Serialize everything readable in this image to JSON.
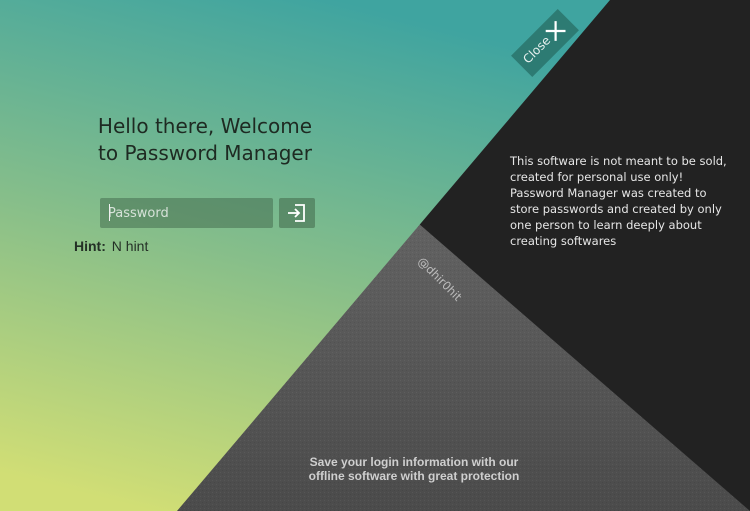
{
  "welcome": {
    "line1": "Hello there, Welcome",
    "line2": "to Password Manager"
  },
  "password": {
    "placeholder": "Password",
    "value": ""
  },
  "login": {
    "icon": "login-arrow-icon"
  },
  "hint": {
    "label": "Hint:",
    "value": "N hint"
  },
  "close": {
    "label": "Close",
    "icon": "close-x-icon"
  },
  "info": {
    "text": "This software is not meant to be sold, created for personal use only! Password Manager was created to store passwords and created by only one person to learn deeply about creating softwares"
  },
  "watermark": {
    "text": "@dhir0hit"
  },
  "tagline": {
    "line1": "Save your login information with our",
    "line2": "offline software with great protection"
  },
  "colors": {
    "gradient_top": "#3fa4a0",
    "gradient_bottom": "#cedd78",
    "dark_panel": "#222222",
    "gray_panel": "#5a5a5a",
    "close_button": "#2d7b73"
  }
}
